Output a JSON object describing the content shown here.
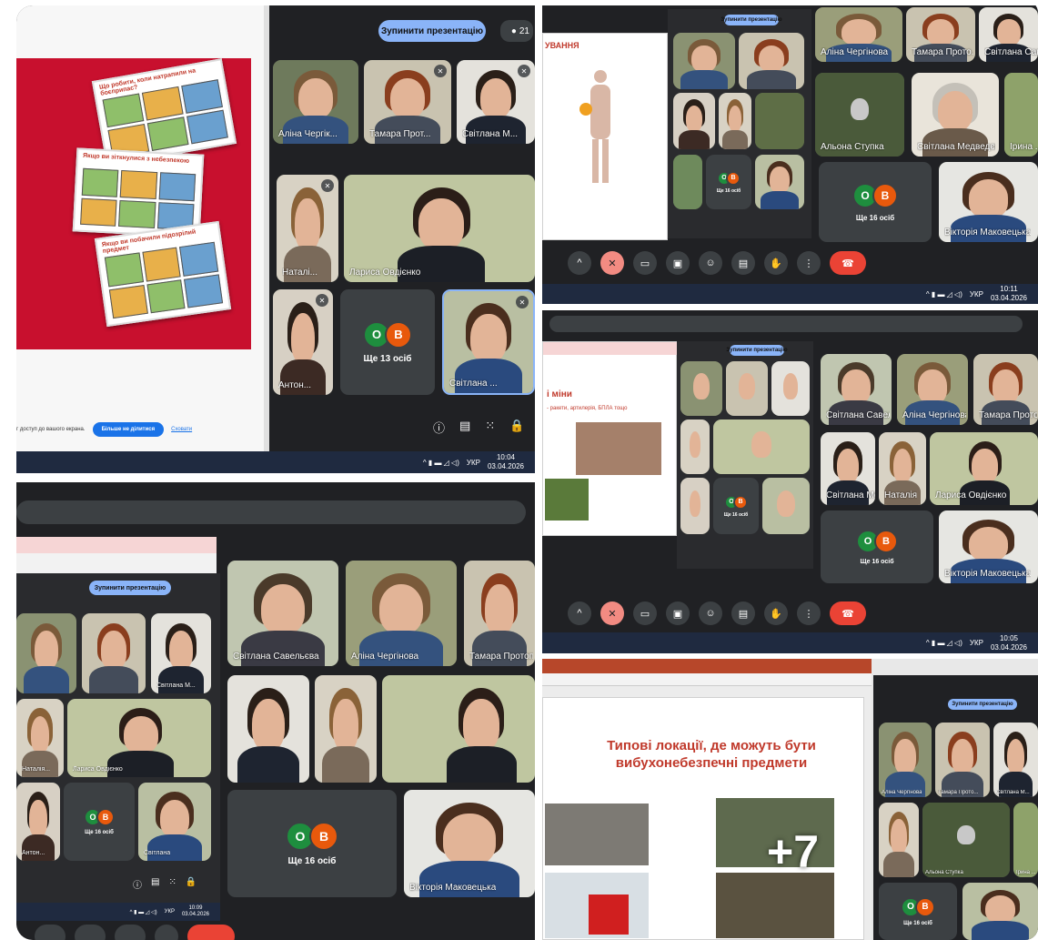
{
  "panel1": {
    "stop_button": "Зупинити презентацію",
    "participant_count": "21",
    "share_notice": "г доступ до вашого екрана.",
    "stop_sharing_button": "Більше не ділитися",
    "hide_link": "Сховати",
    "participants": [
      "Аліна Чергік...",
      "Тамара Прот...",
      "Світлана М...",
      "Наталі...",
      "Лариса Овдієнко",
      "Антон...",
      "Світлана ..."
    ],
    "more": "Ще 13 осіб",
    "taskbar": {
      "lang": "УКР",
      "time": "10:04",
      "date": "03.04.2026"
    }
  },
  "panel2": {
    "slide_heading": "УВАННЯ",
    "participants": [
      "Аліна Чергінова",
      "Тамара Прото...",
      "Світлана Саве...",
      "Альона Ступка",
      "Світлана Медведєва",
      "Ірина ...",
      "Вікторія Маковецька"
    ],
    "more": "Ще 16 осіб",
    "taskbar": {
      "lang": "УКР",
      "time": "10:11",
      "date": "03.04.2026"
    }
  },
  "panel3": {
    "slide_heading": "і міни",
    "slide_sub": "- ракети, артилерія, БПЛА тощо",
    "participants": [
      "Світлана Савельєва",
      "Аліна Чергінова",
      "Тамара Протопопова",
      "Світлана Медведєва",
      "Наталія",
      "Лариса Овдієнко",
      "Вікторія Маковецька"
    ],
    "more": "Ще 16 осіб",
    "taskbar": {
      "lang": "УКР",
      "time": "10:05",
      "date": "03.04.2026"
    }
  },
  "panel4": {
    "stop_button": "Зупинити презентацію",
    "participants": [
      "Світлана Савельєва",
      "Аліна Чергінова",
      "Тамара Протопопова",
      "Світлана М...",
      "Наталія...",
      "Лариса Овдієнко",
      "Антон...",
      "Світлана"
    ],
    "more_small": "Ще 16 осіб",
    "more": "Ще 16 осіб",
    "presenter": "Вікторія Маковецька",
    "taskbar": {
      "lang": "УКР",
      "time": "10:09",
      "date": "03.04.2026"
    }
  },
  "panel5": {
    "slide_title": "Типові локації, де можуть бути вибухонебезпечні предмети",
    "overlay_count": "+7",
    "participants": [
      "Аліна Чергінова",
      "Тамара Прото...",
      "Світлана М...",
      "Альона Ступка",
      "Ірина ..."
    ],
    "more": "Ще 16 осіб",
    "stop_button": "Зупинити презентацію"
  },
  "colors": {
    "meet_bg": "#202124",
    "tile_dark": "#3c4043",
    "avatar_green": "#1e8e3e",
    "avatar_orange": "#e8590c",
    "hangup": "#ea4335",
    "slide_red": "#c0392b",
    "comic_red": "#c8102e"
  }
}
